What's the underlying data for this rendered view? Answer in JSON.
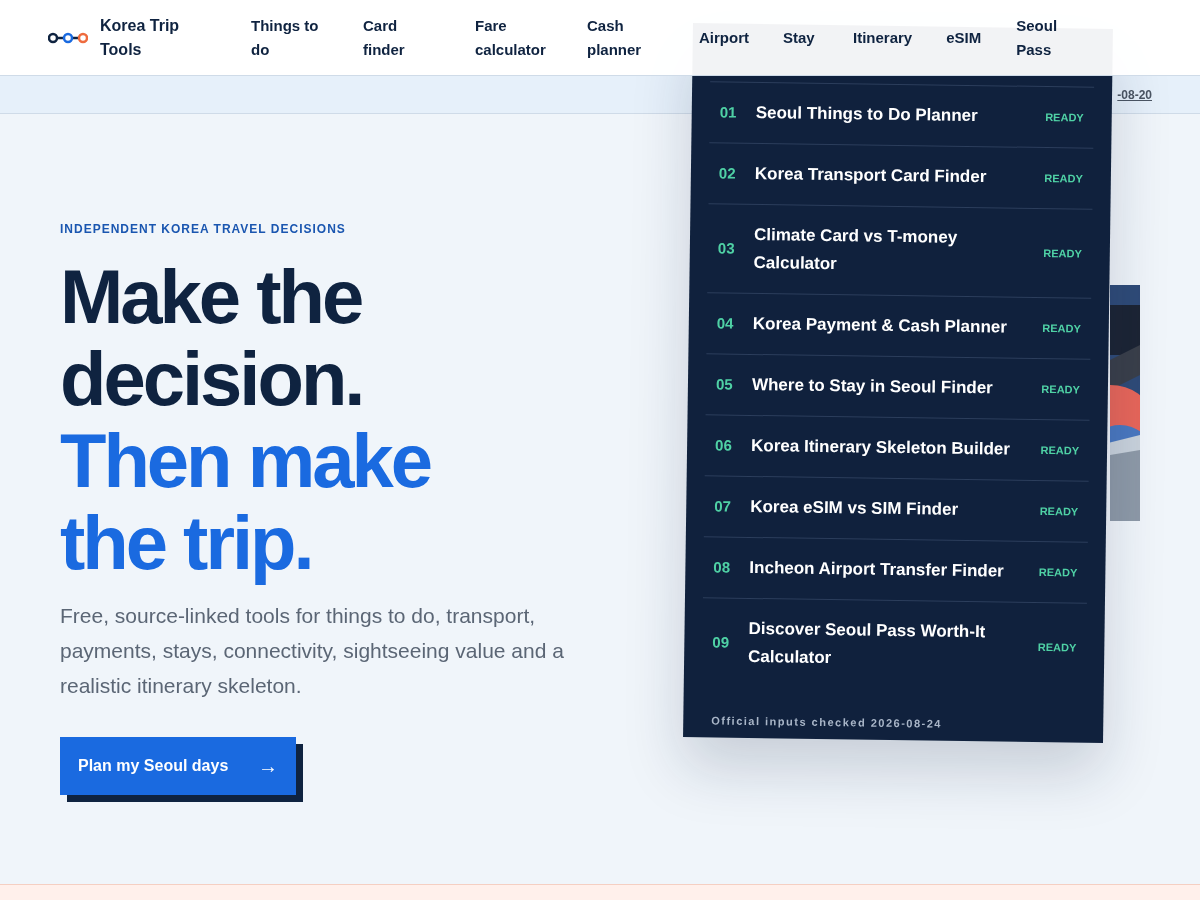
{
  "brand": {
    "name": "Korea Trip Tools"
  },
  "nav": [
    {
      "label": "Things to do"
    },
    {
      "label": "Card finder"
    },
    {
      "label": "Fare calculator"
    },
    {
      "label": "Cash planner"
    },
    {
      "label": "Airport"
    },
    {
      "label": "Stay"
    },
    {
      "label": "Itinerary"
    },
    {
      "label": "eSIM"
    },
    {
      "label": "Seoul Pass"
    }
  ],
  "notice": {
    "link": "-08-20"
  },
  "hero": {
    "eyebrow": "INDEPENDENT KOREA TRAVEL DECISIONS",
    "headline_lines": [
      {
        "text": "Make the decision.",
        "accent": false
      },
      {
        "text": "Then make the trip.",
        "accent": true
      }
    ],
    "lead": "Free, source-linked tools for things to do, transport, payments, stays, connectivity, sightseeing value and a realistic itinerary skeleton.",
    "cta": {
      "label": "Plan my Seoul days",
      "icon": "→"
    }
  },
  "panel": {
    "tools": [
      {
        "number": "01",
        "title": "Seoul Things to Do Planner",
        "status": "READY"
      },
      {
        "number": "02",
        "title": "Korea Transport Card Finder",
        "status": "READY"
      },
      {
        "number": "03",
        "title": "Climate Card vs T-money Calculator",
        "status": "READY"
      },
      {
        "number": "04",
        "title": "Korea Payment & Cash Planner",
        "status": "READY"
      },
      {
        "number": "05",
        "title": "Where to Stay in Seoul Finder",
        "status": "READY"
      },
      {
        "number": "06",
        "title": "Korea Itinerary Skeleton Builder",
        "status": "READY"
      },
      {
        "number": "07",
        "title": "Korea eSIM vs SIM Finder",
        "status": "READY"
      },
      {
        "number": "08",
        "title": "Incheon Airport Transfer Finder",
        "status": "READY"
      },
      {
        "number": "09",
        "title": "Discover Seoul Pass Worth-It Calculator",
        "status": "READY"
      }
    ],
    "footer": "Official inputs checked 2026-08-24"
  }
}
